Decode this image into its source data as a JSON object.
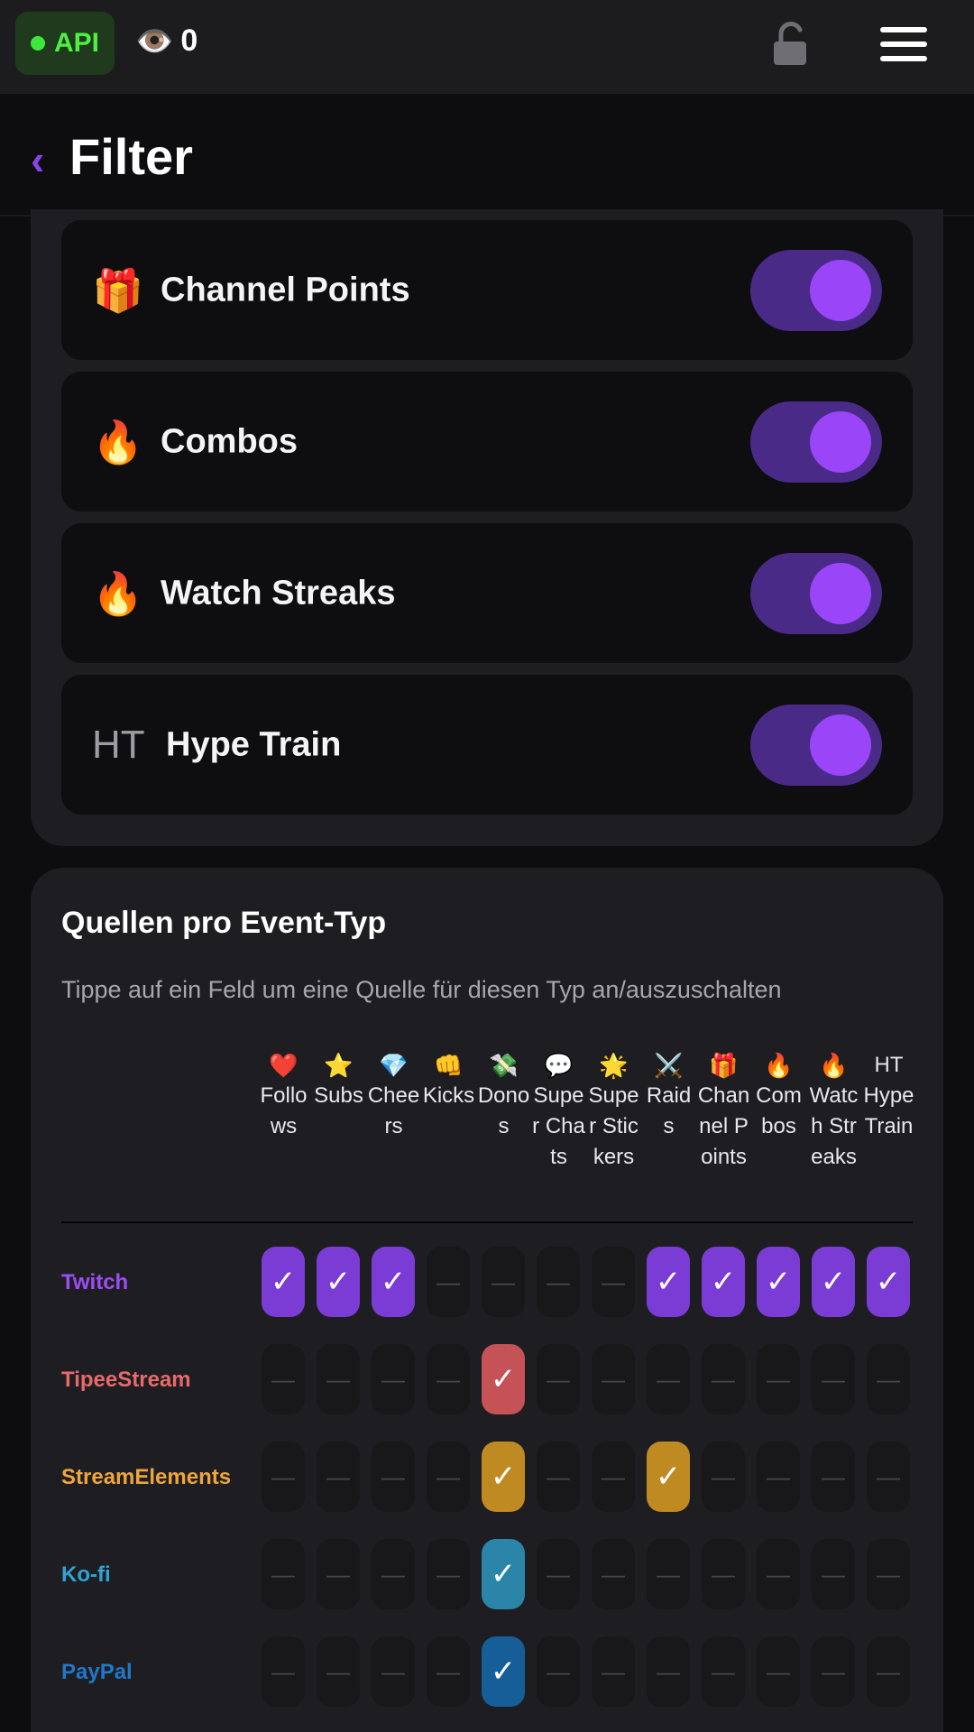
{
  "topbar": {
    "api_label": "API",
    "viewer_count": "0",
    "icons": [
      "eye-icon",
      "unlock-icon",
      "menu-icon"
    ]
  },
  "header": {
    "back_icon": "‹",
    "title": "Filter"
  },
  "toggles": [
    {
      "icon": "🎁",
      "label": "Channel Points",
      "enabled": true
    },
    {
      "icon": "🔥",
      "label": "Combos",
      "enabled": true
    },
    {
      "icon": "🔥",
      "label": "Watch Streaks",
      "enabled": true
    },
    {
      "icon": "HT",
      "label": "Hype Train",
      "enabled": true
    }
  ],
  "sources_section": {
    "title": "Quellen pro Event-Typ",
    "description": "Tippe auf ein Feld um eine Quelle für diesen Typ an/auszuschalten",
    "columns": [
      {
        "icon": "❤️",
        "label": "Follows"
      },
      {
        "icon": "⭐",
        "label": "Subs"
      },
      {
        "icon": "💎",
        "label": "Cheers"
      },
      {
        "icon": "👊",
        "label": "Kicks"
      },
      {
        "icon": "💸",
        "label": "Donos"
      },
      {
        "icon": "💬",
        "label": "Super Chats"
      },
      {
        "icon": "🌟",
        "label": "Super Stickers"
      },
      {
        "icon": "⚔️",
        "label": "Raids"
      },
      {
        "icon": "🎁",
        "label": "Channel Points"
      },
      {
        "icon": "🔥",
        "label": "Combos"
      },
      {
        "icon": "🔥",
        "label": "Watch Streaks"
      },
      {
        "icon": "HT",
        "label": "Hype Train"
      }
    ],
    "check_mark": "✓",
    "off_mark": "—",
    "sources": [
      {
        "name": "Twitch",
        "color": "#a04cf5",
        "on_color": "#7b3cd6",
        "enabled": [
          true,
          true,
          true,
          false,
          false,
          false,
          false,
          true,
          true,
          true,
          true,
          true
        ]
      },
      {
        "name": "TipeeStream",
        "color": "#e8696b",
        "on_color": "#c45257",
        "enabled": [
          false,
          false,
          false,
          false,
          true,
          false,
          false,
          false,
          false,
          false,
          false,
          false
        ]
      },
      {
        "name": "StreamElements",
        "color": "#eea53b",
        "on_color": "#c08a23",
        "enabled": [
          false,
          false,
          false,
          false,
          true,
          false,
          false,
          true,
          false,
          false,
          false,
          false
        ]
      },
      {
        "name": "Ko-fi",
        "color": "#2fa3d9",
        "on_color": "#2a85a8",
        "enabled": [
          false,
          false,
          false,
          false,
          true,
          false,
          false,
          false,
          false,
          false,
          false,
          false
        ]
      },
      {
        "name": "PayPal",
        "color": "#1f78c8",
        "on_color": "#155e98",
        "enabled": [
          false,
          false,
          false,
          false,
          true,
          false,
          false,
          false,
          false,
          false,
          false,
          false
        ]
      }
    ]
  }
}
